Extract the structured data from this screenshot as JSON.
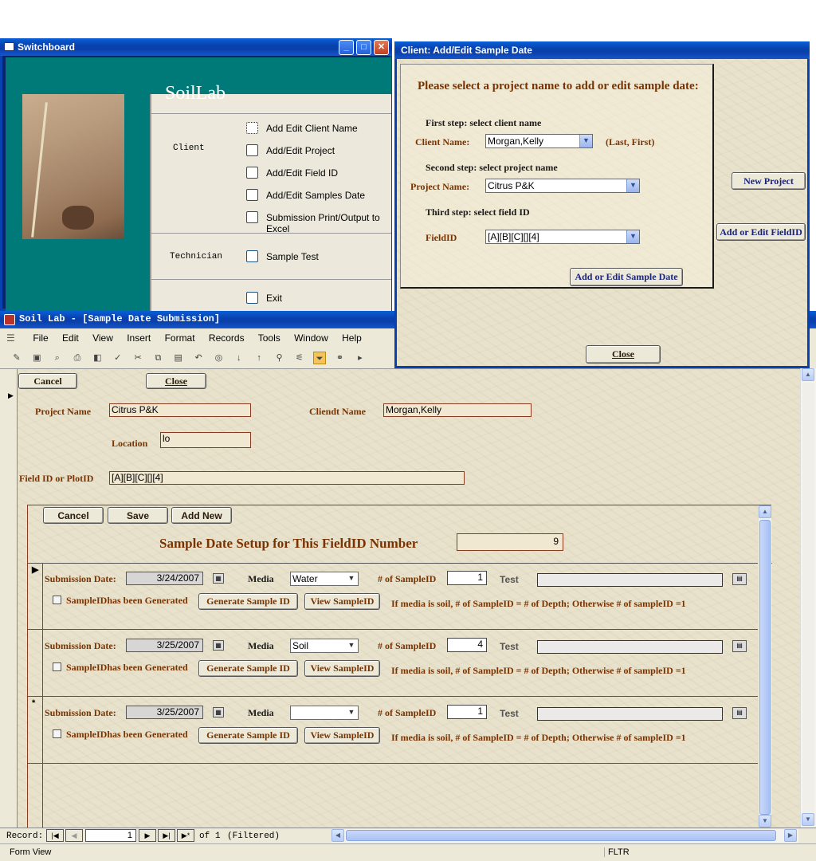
{
  "switchboard": {
    "title": "Switchboard",
    "app_title": "SoilLab",
    "sections": [
      {
        "label": "Client"
      },
      {
        "label": "Technician"
      }
    ],
    "items": [
      "Add Edit Client Name",
      "Add/Edit Project",
      "Add/Edit Field ID",
      "Add/Edit Samples Date",
      "Submission Print/Output to Excel",
      "Sample Test",
      "Exit"
    ]
  },
  "dialog": {
    "title": "Client:   Add/Edit Sample Date",
    "heading": "Please select a project name to add or edit sample date:",
    "step1": "First step: select client name",
    "client_label": "Client Name:",
    "client_value": "Morgan,Kelly",
    "client_hint": "(Last, First)",
    "step2": "Second step: select project name",
    "project_label": "Project Name:",
    "project_value": "Citrus P&K",
    "step3": "Third step: select field ID",
    "fieldid_label": "FieldID",
    "fieldid_value": "[A][B][C][][4]",
    "btn_add_edit_sample": "Add or Edit Sample Date",
    "btn_new_project": "New Project",
    "btn_add_edit_fieldid": "Add or Edit FieldID",
    "btn_close": "Close"
  },
  "main": {
    "title": "Soil Lab - [Sample Date Submission]",
    "menu": [
      "File",
      "Edit",
      "View",
      "Insert",
      "Format",
      "Records",
      "Tools",
      "Window",
      "Help"
    ],
    "form": {
      "cancel": "Cancel",
      "close": "Close",
      "project_name_label": "Project Name",
      "project_name": "Citrus P&K",
      "client_name_label": "Cliendt Name",
      "client_name": "Morgan,Kelly",
      "location_label": "Location",
      "location": "lo",
      "fieldid_label": "Field ID or PlotID",
      "fieldid": "[A][B][C][][4]"
    },
    "sub": {
      "cancel": "Cancel",
      "save": "Save",
      "add_new": "Add New",
      "heading": "Sample Date Setup for This FieldID Number",
      "count": "9",
      "rows": [
        {
          "marker": "▶",
          "date": "3/24/2007",
          "media": "Water",
          "num": "1"
        },
        {
          "marker": "",
          "date": "3/25/2007",
          "media": "Soil",
          "num": "4"
        },
        {
          "marker": "*",
          "date": "3/25/2007",
          "media": "",
          "num": "1"
        }
      ],
      "sub_date_label": "Submission Date:",
      "media_label": "Media",
      "num_label": "# of SampleID",
      "test_label": "Test",
      "generated_label": "SampleIDhas been Generated",
      "gen_btn": "Generate Sample ID",
      "view_btn": "View SampleID",
      "note": "If media is soil, # of SampleID = # of Depth; Otherwise # of sampleID =1"
    },
    "nav": {
      "record_label": "Record:",
      "current": "1",
      "of": "of",
      "total": "1",
      "filtered": "(Filtered)"
    },
    "status": {
      "view": "Form View",
      "fltr": "FLTR"
    }
  }
}
